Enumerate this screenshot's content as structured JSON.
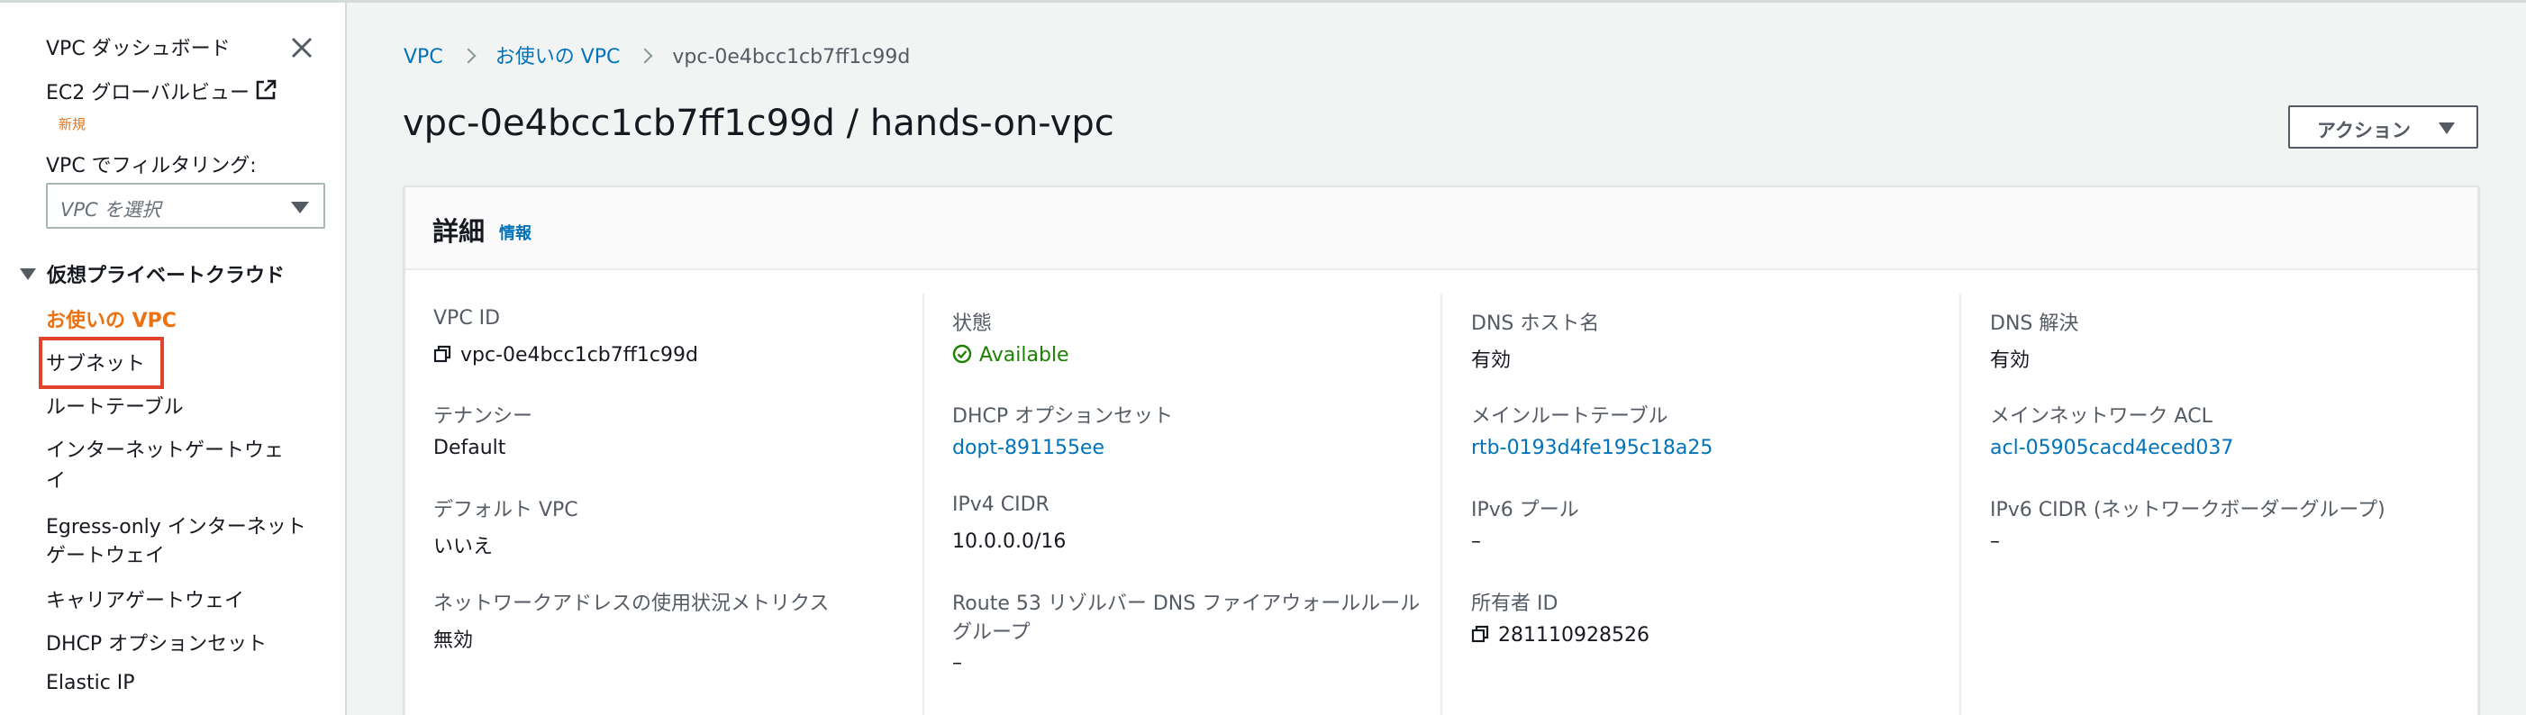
{
  "sidebar": {
    "dashboard": "VPC ダッシュボード",
    "ec2_global_view": "EC2 グローバルビュー",
    "new_badge": "新規",
    "filter_label": "VPC でフィルタリング:",
    "filter_placeholder": "VPC を選択",
    "section_title": "仮想プライベートクラウド",
    "items": [
      {
        "label": "お使いの VPC"
      },
      {
        "label": "サブネット"
      },
      {
        "label": "ルートテーブル"
      },
      {
        "label": "インターネットゲートウェイ"
      },
      {
        "label": "Egress-only インターネットゲートウェイ"
      },
      {
        "label": "キャリアゲートウェイ"
      },
      {
        "label": "DHCP オプションセット"
      },
      {
        "label": "Elastic IP"
      }
    ],
    "items_wrapped": {
      "igw_line1": "インターネットゲートウェ",
      "igw_line2": "イ",
      "egress_line1": "Egress-only インターネット",
      "egress_line2": "ゲートウェイ"
    }
  },
  "breadcrumb": [
    "VPC",
    "お使いの VPC",
    "vpc-0e4bcc1cb7ff1c99d"
  ],
  "page_title": "vpc-0e4bcc1cb7ff1c99d / hands-on-vpc",
  "actions_button": "アクション",
  "details": {
    "title": "詳細",
    "info_link": "情報",
    "col1": {
      "vpc_id_label": "VPC ID",
      "vpc_id_value": "vpc-0e4bcc1cb7ff1c99d",
      "tenancy_label": "テナンシー",
      "tenancy_value": "Default",
      "default_vpc_label": "デフォルト VPC",
      "default_vpc_value": "いいえ",
      "metrics_label": "ネットワークアドレスの使用状況メトリクス",
      "metrics_value": "無効"
    },
    "col2": {
      "state_label": "状態",
      "state_value": "Available",
      "dhcp_label": "DHCP オプションセット",
      "dhcp_value": "dopt-891155ee",
      "ipv4_label": "IPv4 CIDR",
      "ipv4_value": "10.0.0.0/16",
      "r53_label_line1": "Route 53 リゾルバー DNS ファイアウォールルール",
      "r53_label_line2": "グループ",
      "r53_value": "–"
    },
    "col3": {
      "dns_host_label": "DNS ホスト名",
      "dns_host_value": "有効",
      "main_rt_label": "メインルートテーブル",
      "main_rt_value": "rtb-0193d4fe195c18a25",
      "ipv6_pool_label": "IPv6 プール",
      "ipv6_pool_value": "–",
      "owner_label": "所有者 ID",
      "owner_value": "281110928526"
    },
    "col4": {
      "dns_res_label": "DNS 解決",
      "dns_res_value": "有効",
      "main_acl_label": "メインネットワーク ACL",
      "main_acl_value": "acl-05905cacd4eced037",
      "ipv6_cidr_label": "IPv6 CIDR (ネットワークボーダーグループ)",
      "ipv6_cidr_value": "–"
    }
  },
  "colors": {
    "link": "#0073bb",
    "active": "#ec7211",
    "available": "#1d8102",
    "highlight": "#e0452c"
  }
}
